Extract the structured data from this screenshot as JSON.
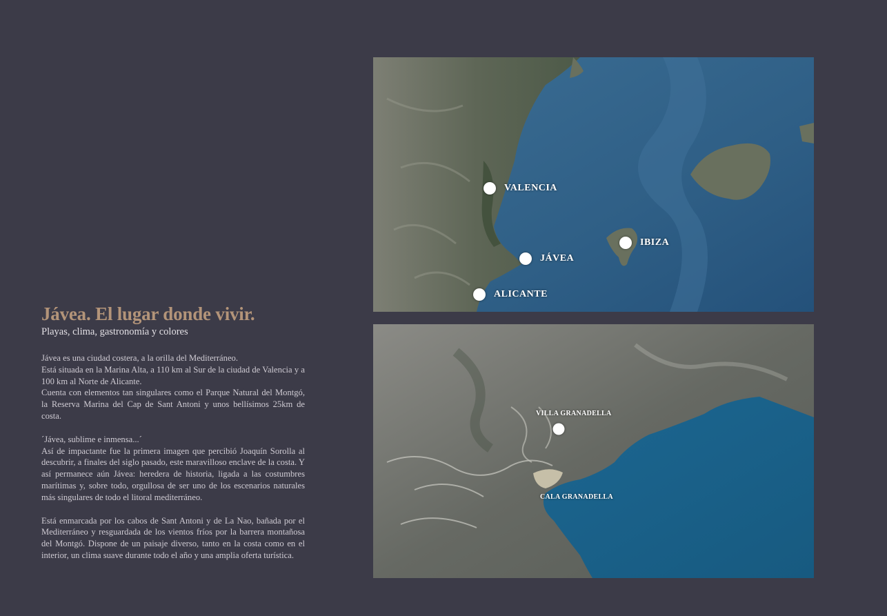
{
  "intro": {
    "title": "Jávea. El lugar donde vivir.",
    "subtitle": "Playas, clima, gastronomía y colores",
    "paragraphs": [
      [
        "Jávea es una ciudad costera, a la orilla del Mediterráneo.",
        "Está situada en la Marina Alta, a 110 km al Sur de la ciudad de Valencia y a 100 km al Norte de Alicante.",
        "Cuenta con elementos tan singulares como el Parque Natural del Montgó, la Reserva Marina del Cap de Sant Antoni y unos bellísimos 25km de costa."
      ],
      [
        "´Jávea, sublime e inmensa...´",
        "Así de impactante fue la primera imagen que percibió Joaquín Sorolla al descubrir, a finales del siglo pasado, este maravilloso enclave de la costa. Y así permanece aún Jávea: heredera de historia, ligada a las costumbres marítimas y, sobre todo, orgullosa de ser uno de los escenarios naturales más singulares de todo el litoral mediterráneo."
      ],
      [
        "Está enmarcada por los cabos de Sant Antoni y de La Nao, bañada por el Mediterráneo y resguardada de los vientos fríos por la barrera montañosa del Montgó. Dispone de un paisaje diverso, tanto en la costa como en el interior, un clima suave durante todo el año y una amplia oferta turística."
      ]
    ]
  },
  "maps": {
    "regional": {
      "places": [
        {
          "name": "VALENCIA"
        },
        {
          "name": "JÁVEA"
        },
        {
          "name": "ALICANTE"
        },
        {
          "name": "IBIZA"
        }
      ]
    },
    "local": {
      "places": [
        {
          "name": "VILLA GRANADELLA"
        },
        {
          "name": "CALA GRANADELLA"
        }
      ]
    }
  },
  "colors": {
    "background": "#3c3b48",
    "title": "#b39479",
    "sea": "#2f5f86",
    "land": "#6b6d63",
    "marker": "#ffffff"
  }
}
